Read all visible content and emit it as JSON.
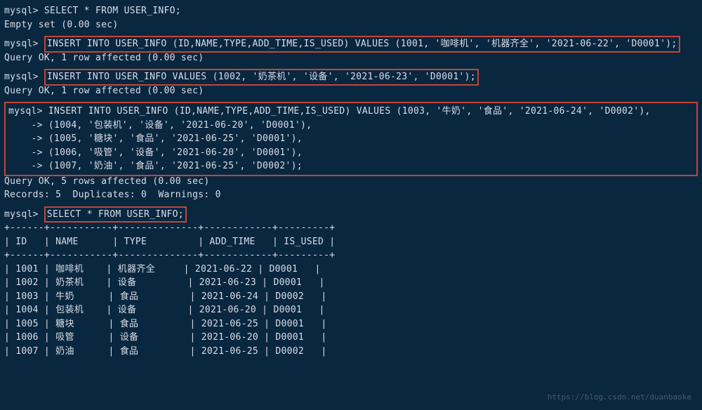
{
  "lines": {
    "l1": "mysql> SELECT * FROM USER_INFO;",
    "l2": "Empty set (0.00 sec)",
    "l3_prompt": "mysql> ",
    "l3_box": "INSERT INTO USER_INFO (ID,NAME,TYPE,ADD_TIME,IS_USED) VALUES (1001, '咖啡机', '机器齐全', '2021-06-22', 'D0001');",
    "l4": "Query OK, 1 row affected (0.00 sec)",
    "l5_prompt": "mysql> ",
    "l5_box": "INSERT INTO USER_INFO VALUES (1002, '奶茶机', '设备', '2021-06-23', 'D0001');",
    "l6": "Query OK, 1 row affected (0.00 sec)",
    "l7": "mysql> INSERT INTO USER_INFO (ID,NAME,TYPE,ADD_TIME,IS_USED) VALUES (1003, '牛奶', '食品', '2021-06-24', 'D0002'),",
    "l8": "    -> (1004, '包装机', '设备', '2021-06-20', 'D0001'),",
    "l9": "    -> (1005, '糖块', '食品', '2021-06-25', 'D0001'),",
    "l10": "    -> (1006, '吸管', '设备', '2021-06-20', 'D0001'),",
    "l11": "    -> (1007, '奶油', '食品', '2021-06-25', 'D0002');",
    "l12": "Query OK, 5 rows affected (0.00 sec)",
    "l13": "Records: 5  Duplicates: 0  Warnings: 0",
    "l14_prompt": "mysql> ",
    "l14_box": "SELECT * FROM USER_INFO;",
    "sep": "+------+-----------+--------------+------------+---------+",
    "header": "| ID   | NAME      | TYPE         | ADD_TIME   | IS_USED |",
    "r1": "| 1001 | 咖啡机    | 机器齐全     | 2021-06-22 | D0001   |",
    "r2": "| 1002 | 奶茶机    | 设备         | 2021-06-23 | D0001   |",
    "r3": "| 1003 | 牛奶      | 食品         | 2021-06-24 | D0002   |",
    "r4": "| 1004 | 包装机    | 设备         | 2021-06-20 | D0001   |",
    "r5": "| 1005 | 糖块      | 食品         | 2021-06-25 | D0001   |",
    "r6": "| 1006 | 吸管      | 设备         | 2021-06-20 | D0001   |",
    "r7": "| 1007 | 奶油      | 食品         | 2021-06-25 | D0002   |"
  },
  "watermark": "https://blog.csdn.net/duanbaoke",
  "chart_data": {
    "type": "table",
    "title": "USER_INFO",
    "columns": [
      "ID",
      "NAME",
      "TYPE",
      "ADD_TIME",
      "IS_USED"
    ],
    "rows": [
      [
        1001,
        "咖啡机",
        "机器齐全",
        "2021-06-22",
        "D0001"
      ],
      [
        1002,
        "奶茶机",
        "设备",
        "2021-06-23",
        "D0001"
      ],
      [
        1003,
        "牛奶",
        "食品",
        "2021-06-24",
        "D0002"
      ],
      [
        1004,
        "包装机",
        "设备",
        "2021-06-20",
        "D0001"
      ],
      [
        1005,
        "糖块",
        "食品",
        "2021-06-25",
        "D0001"
      ],
      [
        1006,
        "吸管",
        "设备",
        "2021-06-20",
        "D0001"
      ],
      [
        1007,
        "奶油",
        "食品",
        "2021-06-25",
        "D0002"
      ]
    ]
  }
}
